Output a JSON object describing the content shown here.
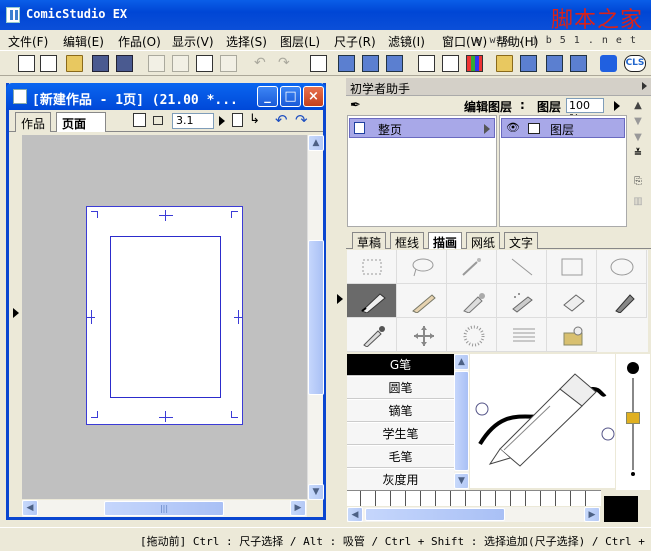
{
  "app": {
    "title": "ComicStudio EX",
    "brand_mark": "脚本之家",
    "watermark_url": "w w w . j b 5 1 . n e t"
  },
  "menu": [
    "文件(F)",
    "编辑(E)",
    "作品(O)",
    "显示(V)",
    "选择(S)",
    "图层(L)",
    "尺子(R)",
    "滤镜(I)",
    "窗口(W)",
    "帮助(H)"
  ],
  "toolbar": {
    "logo_label": "CLS"
  },
  "document": {
    "title": "[新建作品 - 1页] (21.00 *...",
    "tabs": [
      "作品",
      "页面"
    ],
    "tab_close": "×",
    "page_number": "3.1",
    "scroll_grip": "|||"
  },
  "assistant": {
    "title": "初学者助手",
    "edit_layer_label": "编辑图层",
    "layer_label": "图层",
    "zoom": "100 %",
    "tree_item": "整页",
    "layer_item": "图层"
  },
  "tool_tabs": [
    "草稿",
    "框线",
    "描画",
    "网纸",
    "文字"
  ],
  "active_tool_tab": "描画",
  "pens": [
    "G笔",
    "圆笔",
    "镝笔",
    "学生笔",
    "毛笔",
    "灰度用"
  ],
  "active_pen": "G笔",
  "status": {
    "text": "[拖动前] Ctrl : 尺子选择 / Alt : 吸管 / Ctrl + Shift : 选择追加(尺子选择) / Ctrl +"
  },
  "colors": {
    "titlebar": "#0a5ee8",
    "brand": "#d8231b",
    "page_border": "#3b3bd6",
    "selection": "#a8a8e8"
  }
}
